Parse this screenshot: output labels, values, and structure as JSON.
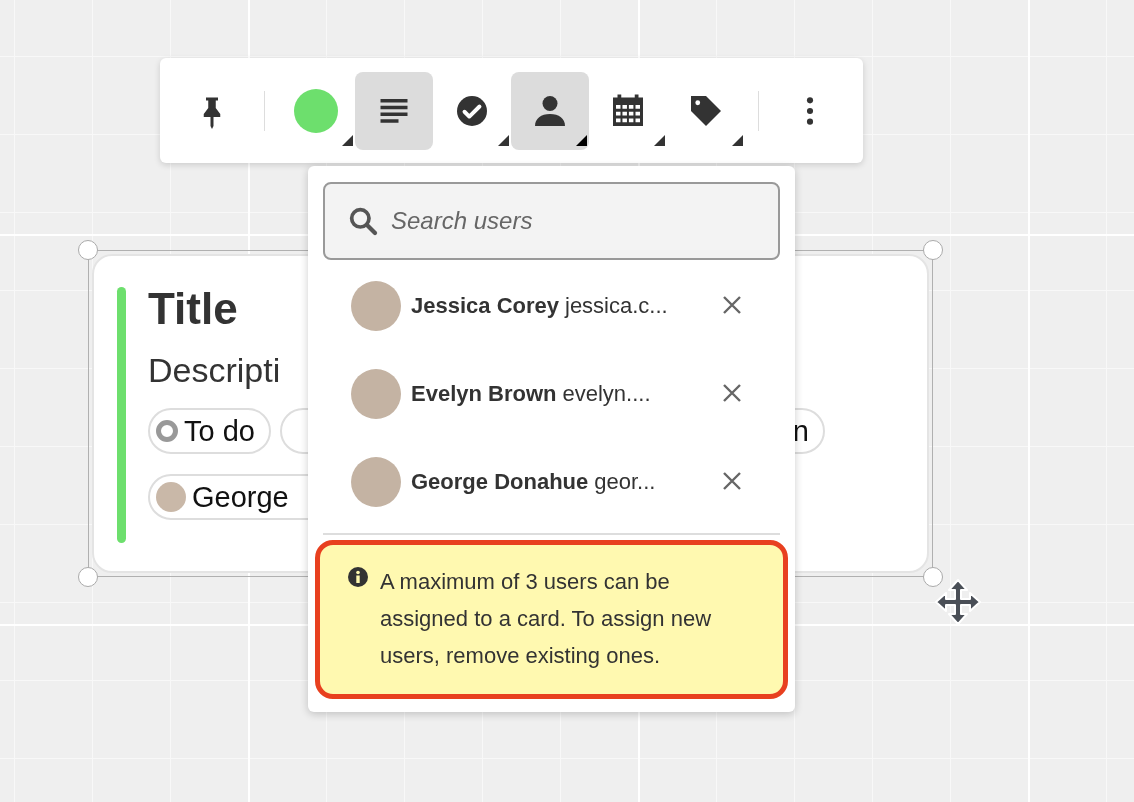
{
  "toolbar": {
    "buttons": [
      {
        "kind": "pin",
        "selected": false,
        "dropdown": false
      },
      {
        "kind": "divider"
      },
      {
        "kind": "color",
        "color": "#6ddf6d",
        "selected": false,
        "dropdown": true
      },
      {
        "kind": "text",
        "selected": true,
        "dropdown": false
      },
      {
        "kind": "status",
        "selected": false,
        "dropdown": true
      },
      {
        "kind": "users",
        "selected": true,
        "dropdown": true
      },
      {
        "kind": "date",
        "selected": false,
        "dropdown": true
      },
      {
        "kind": "tag",
        "selected": false,
        "dropdown": true
      },
      {
        "kind": "divider"
      },
      {
        "kind": "more",
        "selected": false,
        "dropdown": false
      }
    ]
  },
  "card": {
    "title": "Title",
    "description": "Descripti",
    "chip_rows": [
      [
        {
          "kind": "status",
          "label": "To do"
        },
        {
          "kind": "hidden"
        },
        {
          "kind": "plain",
          "label": "n"
        }
      ],
      [
        {
          "kind": "user",
          "label": "George"
        }
      ]
    ]
  },
  "user_picker": {
    "search": {
      "placeholder": "Search users"
    },
    "users": [
      {
        "name": "Jessica Corey",
        "email": "jessica.c..."
      },
      {
        "name": "Evelyn Brown",
        "email": "evelyn...."
      },
      {
        "name": "George Donahue",
        "email": "geor..."
      }
    ],
    "notice": {
      "text": "A maximum of 3 users can be assigned to a card. To assign new users, remove existing ones."
    }
  }
}
